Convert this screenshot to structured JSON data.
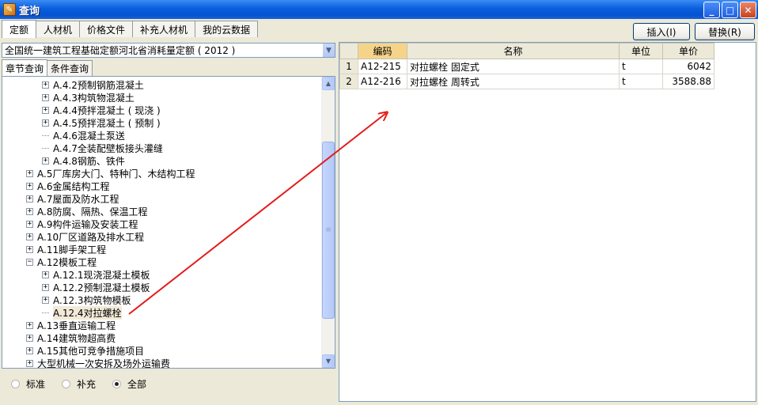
{
  "window": {
    "title": "查询"
  },
  "tabs": [
    "定额",
    "人材机",
    "价格文件",
    "补充人材机",
    "我的云数据"
  ],
  "toolbar": {
    "insert_label": "插入(I)",
    "replace_label": "替换(R)"
  },
  "quota_select": {
    "value": "全国统一建筑工程基础定额河北省消耗量定额 ( 2012 )"
  },
  "subtabs": [
    "章节查询",
    "条件查询"
  ],
  "tree": [
    {
      "label": "A.4.2预制钢筋混凝土",
      "expander": "+"
    },
    {
      "label": "A.4.3构筑物混凝土",
      "expander": "+"
    },
    {
      "label": "A.4.4预拌混凝土 ( 现浇 )",
      "expander": "+"
    },
    {
      "label": "A.4.5预拌混凝土 ( 预制 )",
      "expander": "+"
    },
    {
      "label": "A.4.6混凝土泵送",
      "expander": ""
    },
    {
      "label": "A.4.7全装配壁板接头灌缝",
      "expander": ""
    },
    {
      "label": "A.4.8钢筋、铁件",
      "expander": "+"
    },
    {
      "label": "A.5厂库房大门、特种门、木结构工程",
      "expander": "+"
    },
    {
      "label": "A.6金属结构工程",
      "expander": "+"
    },
    {
      "label": "A.7屋面及防水工程",
      "expander": "+"
    },
    {
      "label": "A.8防腐、隔热、保温工程",
      "expander": "+"
    },
    {
      "label": "A.9构件运输及安装工程",
      "expander": "+"
    },
    {
      "label": "A.10厂区道路及排水工程",
      "expander": "+"
    },
    {
      "label": "A.11脚手架工程",
      "expander": "+"
    },
    {
      "label": "A.12模板工程",
      "expander": "−"
    },
    {
      "label": "A.12.1现浇混凝土模板",
      "expander": "+"
    },
    {
      "label": "A.12.2预制混凝土模板",
      "expander": "+"
    },
    {
      "label": "A.12.3构筑物模板",
      "expander": "+"
    },
    {
      "label": "A.12.4对拉螺栓",
      "expander": ""
    },
    {
      "label": "A.13垂直运输工程",
      "expander": "+"
    },
    {
      "label": "A.14建筑物超高费",
      "expander": "+"
    },
    {
      "label": "A.15其他可竞争措施项目",
      "expander": "+"
    },
    {
      "label": "大型机械一次安拆及场外运输费",
      "expander": "+"
    }
  ],
  "filter": {
    "options": [
      "标准",
      "补充",
      "全部"
    ],
    "selected": "全部"
  },
  "grid": {
    "columns": [
      "编码",
      "名称",
      "单位",
      "单价"
    ],
    "rows": [
      {
        "no": "1",
        "code": "A12-215",
        "name": "对拉螺栓 固定式",
        "unit": "t",
        "price": "6042"
      },
      {
        "no": "2",
        "code": "A12-216",
        "name": "对拉螺栓 周转式",
        "unit": "t",
        "price": "3588.88"
      }
    ]
  },
  "colors": {
    "titlebar": "#0a5fdc",
    "selected_header": "#f5d48a",
    "annotation_arrow": "#e41a1a"
  },
  "icons": [
    "minimize-icon",
    "maximize-icon",
    "close-icon",
    "dropdown-arrow-icon",
    "scroll-up-icon",
    "scroll-down-icon"
  ]
}
